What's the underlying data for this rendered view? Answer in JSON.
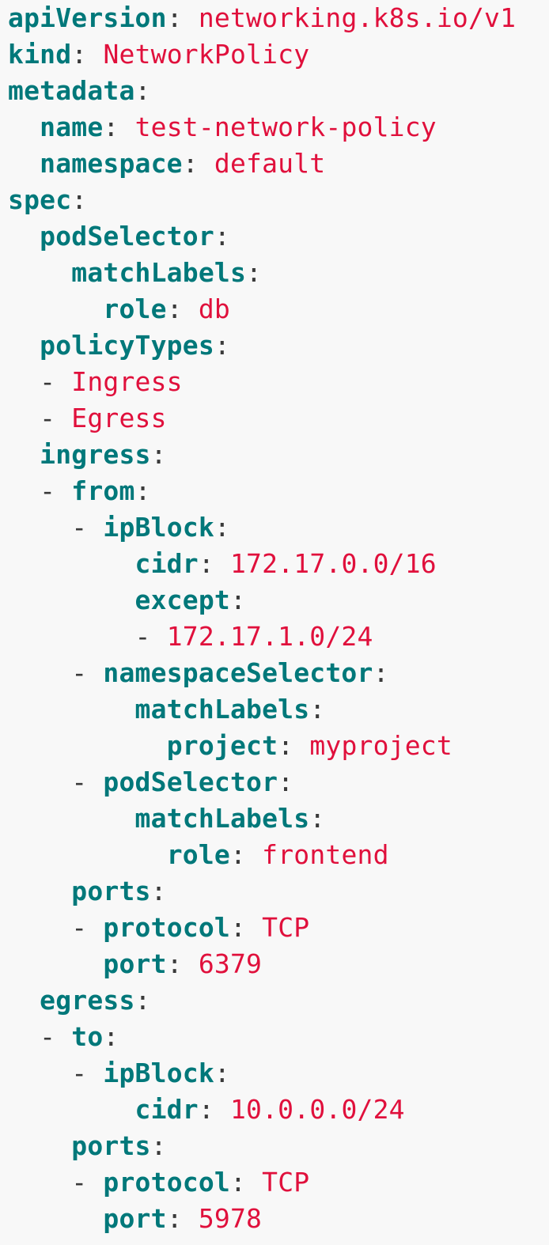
{
  "colors": {
    "background": "#f8f8f8",
    "key": "#00787a",
    "value": "#e0103c",
    "punctuation": "#3a3a3a"
  },
  "lines": [
    {
      "indent": 0,
      "dash": false,
      "key": "apiVersion",
      "value": "networking.k8s.io/v1"
    },
    {
      "indent": 0,
      "dash": false,
      "key": "kind",
      "value": "NetworkPolicy"
    },
    {
      "indent": 0,
      "dash": false,
      "key": "metadata",
      "value": ""
    },
    {
      "indent": 2,
      "dash": false,
      "key": "name",
      "value": "test-network-policy"
    },
    {
      "indent": 2,
      "dash": false,
      "key": "namespace",
      "value": "default"
    },
    {
      "indent": 0,
      "dash": false,
      "key": "spec",
      "value": ""
    },
    {
      "indent": 2,
      "dash": false,
      "key": "podSelector",
      "value": ""
    },
    {
      "indent": 4,
      "dash": false,
      "key": "matchLabels",
      "value": ""
    },
    {
      "indent": 6,
      "dash": false,
      "key": "role",
      "value": "db"
    },
    {
      "indent": 2,
      "dash": false,
      "key": "policyTypes",
      "value": ""
    },
    {
      "indent": 2,
      "dash": true,
      "key": "",
      "value": "Ingress"
    },
    {
      "indent": 2,
      "dash": true,
      "key": "",
      "value": "Egress"
    },
    {
      "indent": 2,
      "dash": false,
      "key": "ingress",
      "value": ""
    },
    {
      "indent": 2,
      "dash": true,
      "key": "from",
      "value": ""
    },
    {
      "indent": 4,
      "dash": true,
      "key": "ipBlock",
      "value": ""
    },
    {
      "indent": 8,
      "dash": false,
      "key": "cidr",
      "value": "172.17.0.0/16"
    },
    {
      "indent": 8,
      "dash": false,
      "key": "except",
      "value": ""
    },
    {
      "indent": 8,
      "dash": true,
      "key": "",
      "value": "172.17.1.0/24"
    },
    {
      "indent": 4,
      "dash": true,
      "key": "namespaceSelector",
      "value": ""
    },
    {
      "indent": 8,
      "dash": false,
      "key": "matchLabels",
      "value": ""
    },
    {
      "indent": 10,
      "dash": false,
      "key": "project",
      "value": "myproject"
    },
    {
      "indent": 4,
      "dash": true,
      "key": "podSelector",
      "value": ""
    },
    {
      "indent": 8,
      "dash": false,
      "key": "matchLabels",
      "value": ""
    },
    {
      "indent": 10,
      "dash": false,
      "key": "role",
      "value": "frontend"
    },
    {
      "indent": 4,
      "dash": false,
      "key": "ports",
      "value": ""
    },
    {
      "indent": 4,
      "dash": true,
      "key": "protocol",
      "value": "TCP"
    },
    {
      "indent": 6,
      "dash": false,
      "key": "port",
      "value": "6379"
    },
    {
      "indent": 2,
      "dash": false,
      "key": "egress",
      "value": ""
    },
    {
      "indent": 2,
      "dash": true,
      "key": "to",
      "value": ""
    },
    {
      "indent": 4,
      "dash": true,
      "key": "ipBlock",
      "value": ""
    },
    {
      "indent": 8,
      "dash": false,
      "key": "cidr",
      "value": "10.0.0.0/24"
    },
    {
      "indent": 4,
      "dash": false,
      "key": "ports",
      "value": ""
    },
    {
      "indent": 4,
      "dash": true,
      "key": "protocol",
      "value": "TCP"
    },
    {
      "indent": 6,
      "dash": false,
      "key": "port",
      "value": "5978"
    }
  ]
}
